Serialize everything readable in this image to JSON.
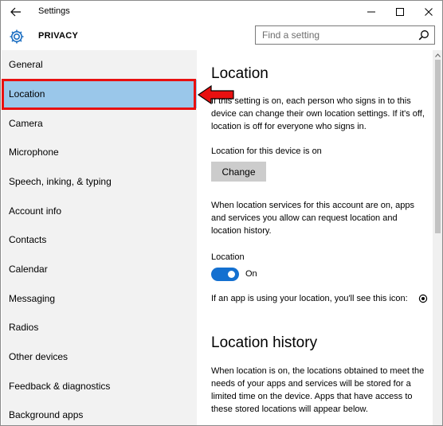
{
  "window": {
    "title": "Settings",
    "back_icon": "back-arrow-icon",
    "controls": [
      "minimize-icon",
      "maximize-icon",
      "close-icon"
    ]
  },
  "header": {
    "icon": "gear-icon",
    "title": "PRIVACY",
    "search_placeholder": "Find a setting",
    "search_icon": "search-icon"
  },
  "sidebar": {
    "items": [
      {
        "label": "General"
      },
      {
        "label": "Location"
      },
      {
        "label": "Camera"
      },
      {
        "label": "Microphone"
      },
      {
        "label": "Speech, inking, & typing"
      },
      {
        "label": "Account info"
      },
      {
        "label": "Contacts"
      },
      {
        "label": "Calendar"
      },
      {
        "label": "Messaging"
      },
      {
        "label": "Radios"
      },
      {
        "label": "Other devices"
      },
      {
        "label": "Feedback & diagnostics"
      },
      {
        "label": "Background apps"
      }
    ],
    "selected": "Location"
  },
  "annotation": {
    "highlight_color": "#e81010",
    "arrow_icon": "red-arrow-icon"
  },
  "main": {
    "location_heading": "Location",
    "location_desc": "If this setting is on, each person who signs in to this device can change their own location settings. If it's off, location is off for everyone who signs in.",
    "device_status": "Location for this device is on",
    "change_button": "Change",
    "services_desc": "When location services for this account are on, apps and services you allow can request location and location history.",
    "toggle_title": "Location",
    "toggle_state": "On",
    "toggle_on": true,
    "icon_hint": "If an app is using your location, you'll see this icon:",
    "icon_hint_icon": "location-in-use-icon",
    "history_heading": "Location history",
    "history_desc": "When location is on, the locations obtained to meet the needs of your apps and services will be stored for a limited time on the device. Apps that have access to these stored locations will appear below."
  },
  "colors": {
    "selected_bg": "#9ac7ea",
    "toggle_on": "#1470d0",
    "button_bg": "#cccccc",
    "sidebar_bg": "#f2f2f2"
  }
}
